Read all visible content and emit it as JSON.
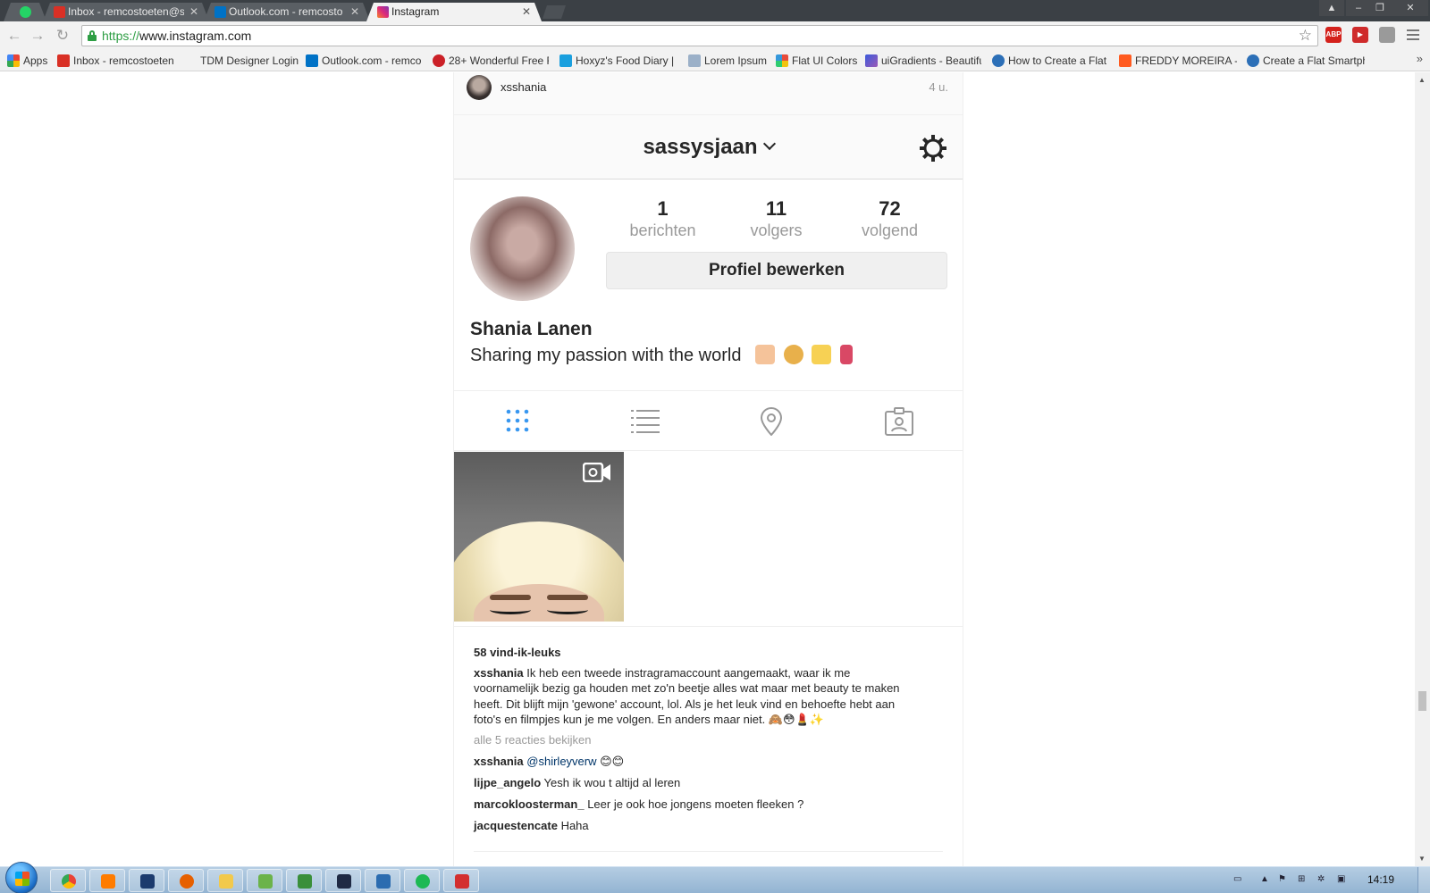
{
  "browser": {
    "tabs": [
      {
        "title": "",
        "icon": "whatsapp-icon",
        "color": "#25d366"
      },
      {
        "title": "Inbox - remcostoeten@sp",
        "icon": "gmail-icon",
        "color": "#d93025"
      },
      {
        "title": "Outlook.com - remcosto",
        "icon": "outlook-icon",
        "color": "#0072c6"
      },
      {
        "title": "Instagram",
        "icon": "instagram-icon",
        "color": "#d6249f"
      }
    ],
    "address": {
      "scheme": "https://",
      "host": "www.instagram.com"
    },
    "extensions": [
      {
        "label": "ABP",
        "color": "#d4221c"
      },
      {
        "label": "▶",
        "color": "#cf2b2b"
      },
      {
        "label": "",
        "color": "#9a9a9a"
      }
    ],
    "bookmarks": [
      {
        "label": "Apps",
        "color": "#e44"
      },
      {
        "label": "Inbox - remcostoeten",
        "color": "#d93025"
      },
      {
        "label": "TDM Designer Login",
        "color": "#f2f2f2"
      },
      {
        "label": "Outlook.com - remco",
        "color": "#0072c6"
      },
      {
        "label": "28+ Wonderful Free F",
        "color": "#cb2027"
      },
      {
        "label": "Hoxyz's Food Diary | F",
        "color": "#1a9fde"
      },
      {
        "label": "Lorem Ipsum",
        "color": "#9bb0c8"
      },
      {
        "label": "Flat UI Colors",
        "color": "#e67e22"
      },
      {
        "label": "uiGradients - Beautifu",
        "color": "#3b5bdb"
      },
      {
        "label": "How to Create a Flat U",
        "color": "#2c6fb7"
      },
      {
        "label": "FREDDY MOREIRA - M",
        "color": "#ff5a1f"
      },
      {
        "label": "Create a Flat Smartpho",
        "color": "#2c6fb7"
      }
    ]
  },
  "instagram": {
    "notification": {
      "username": "xsshania",
      "time": "4 u."
    },
    "header": {
      "username": "sassysjaan"
    },
    "stats": [
      {
        "value": "1",
        "label": "berichten"
      },
      {
        "value": "11",
        "label": "volgers"
      },
      {
        "value": "72",
        "label": "volgend"
      }
    ],
    "edit_profile_label": "Profiel bewerken",
    "full_name": "Shania Lanen",
    "bio": "Sharing my passion with the world",
    "bio_emoji_colors": [
      "#f5c39a",
      "#e8b04b",
      "#f7d154",
      "#d94865"
    ],
    "post": {
      "likes": "58 vind-ik-leuks",
      "caption_user": "xsshania",
      "caption_lines": [
        "Ik heb een tweede instragramaccount aangemaakt, waar ik me",
        "voornamelijk bezig ga houden met zo'n beetje alles wat maar met beauty te maken",
        "heeft. Dit blijft mijn 'gewone' account, lol. Als je het leuk vind en behoefte hebt aan",
        "foto's en filmpjes kun je me volgen. En anders maar niet. 🙈😳💄✨"
      ],
      "view_all": "alle 5 reacties bekijken",
      "comments": [
        {
          "user": "xsshania",
          "mention": "@shirleyverw",
          "text": "😊😊"
        },
        {
          "user": "lijpe_angelo",
          "mention": "",
          "text": "Yesh ik wou t altijd al leren"
        },
        {
          "user": "marcokloosterman_",
          "mention": "",
          "text": "Leer je ook hoe jongens moeten fleeken ?"
        },
        {
          "user": "jacquestencate",
          "mention": "",
          "text": "Haha"
        }
      ]
    }
  },
  "taskbar": {
    "items": [
      {
        "icon": "chrome-icon",
        "color": "#34a853"
      },
      {
        "icon": "illustrator-icon",
        "color": "#ff7c00"
      },
      {
        "icon": "photoshop-icon",
        "color": "#1c3b6e"
      },
      {
        "icon": "firefox-icon",
        "color": "#e66000"
      },
      {
        "icon": "explorer-icon",
        "color": "#f2c94c"
      },
      {
        "icon": "paint-icon",
        "color": "#6bb34a"
      },
      {
        "icon": "app-icon",
        "color": "#3a8f3a"
      },
      {
        "icon": "batman-icon",
        "color": "#1f2a44"
      },
      {
        "icon": "word-icon",
        "color": "#2b6cb0"
      },
      {
        "icon": "spotify-icon",
        "color": "#1db954"
      },
      {
        "icon": "acrobat-icon",
        "color": "#d32f2f"
      }
    ],
    "time": "14:19"
  }
}
